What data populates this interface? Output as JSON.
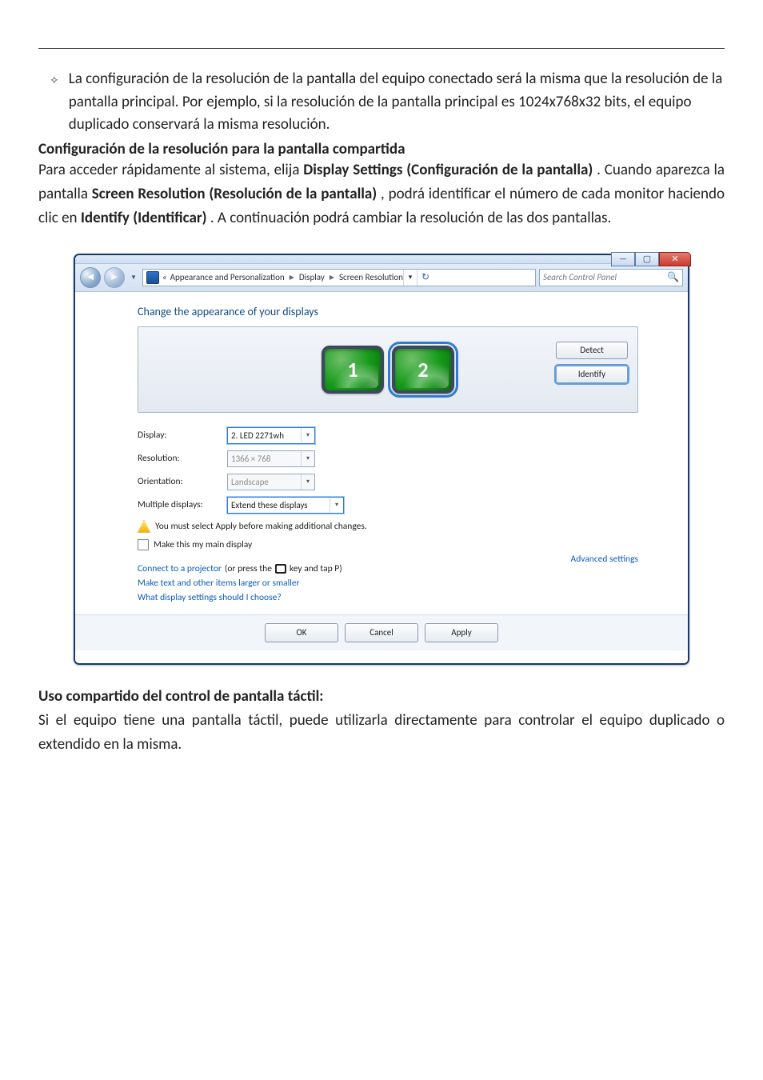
{
  "bullet1": "La configuración de la resolución de la pantalla del equipo conectado será la misma que la resolución de la pantalla principal. Por ejemplo, si la resolución de la pantalla principal es 1024x768x32 bits, el equipo duplicado conservará la misma resolución.",
  "heading1": "Configuración de la resolución para la pantalla compartida",
  "para1_a": "Para acceder rápidamente al sistema, elija ",
  "para1_b": "Display Settings (Configuración de la pantalla)",
  "para1_c": ". Cuando aparezca la pantalla ",
  "para1_d": "Screen Resolution (Resolución de la pantalla)",
  "para1_e": ", podrá identificar el número de cada monitor haciendo clic en ",
  "para1_f": "Identify (Identificar)",
  "para1_g": ". A continuación podrá cambiar la resolución de las dos pantallas.",
  "window": {
    "breadcrumb": {
      "before": "«",
      "seg1": "Appearance and Personalization",
      "seg2": "Display",
      "seg3": "Screen Resolution"
    },
    "search_placeholder": "Search Control Panel",
    "heading": "Change the appearance of your displays",
    "detect": "Detect",
    "identify": "Identify",
    "monitor1": "1",
    "monitor2": "2",
    "labels": {
      "display": "Display:",
      "resolution": "Resolution:",
      "orientation": "Orientation:",
      "multiple": "Multiple displays:"
    },
    "values": {
      "display": "2. LED 2271wh",
      "resolution": "1366 × 768",
      "orientation": "Landscape",
      "multiple": "Extend these displays"
    },
    "warning": "You must select Apply before making additional changes.",
    "make_main": "Make this my main display",
    "advanced": "Advanced settings",
    "link_projector_a": "Connect to a projector",
    "link_projector_b": " (or press the ",
    "link_projector_c": " key and tap P)",
    "link_size": "Make text and other items larger or smaller",
    "link_which": "What display settings should I choose?",
    "ok": "OK",
    "cancel": "Cancel",
    "apply": "Apply"
  },
  "heading2": "Uso compartido del control de pantalla táctil:",
  "para2": "Si el equipo tiene una pantalla táctil, puede utilizarla directamente para controlar el equipo duplicado o extendido en la misma."
}
